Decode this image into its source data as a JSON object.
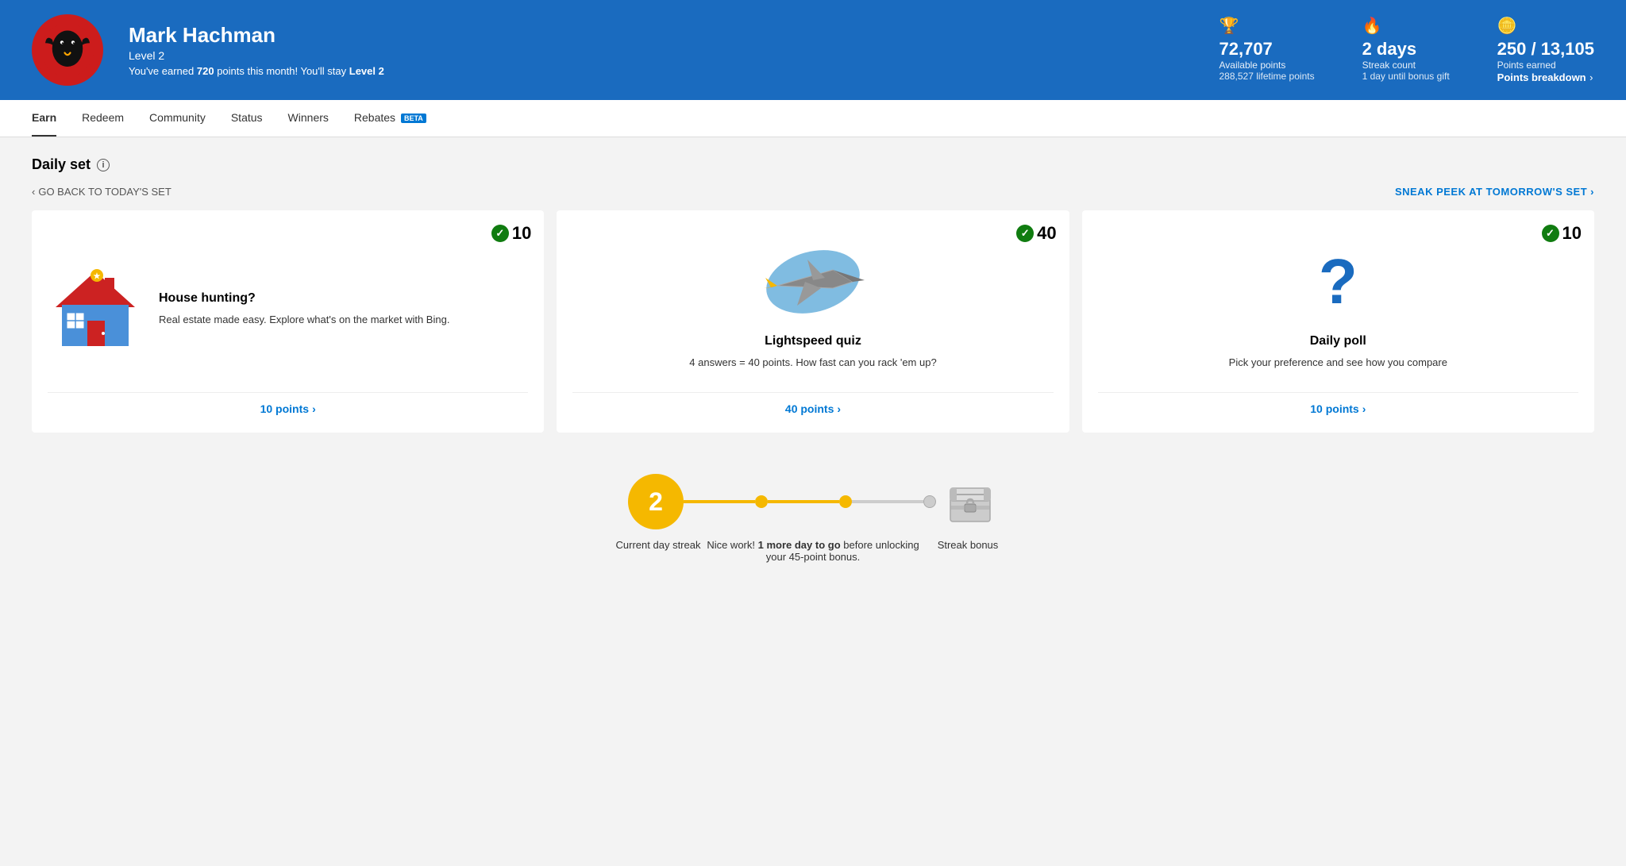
{
  "header": {
    "user": {
      "name": "Mark Hachman",
      "level": "Level 2",
      "monthly_message": "You've earned",
      "monthly_points": "720",
      "monthly_suffix": "points this month! You'll stay",
      "monthly_level": "Level 2"
    },
    "stats": {
      "points": {
        "icon": "trophy",
        "main": "72,707",
        "label": "Available points",
        "sub": "288,527 lifetime points"
      },
      "streak": {
        "icon": "flame",
        "main": "2 days",
        "label": "Streak count",
        "sub": "1 day until bonus gift"
      },
      "earnings": {
        "icon": "coins",
        "main": "250 / 13,105",
        "label": "Points earned",
        "link": "Points breakdown"
      }
    }
  },
  "nav": {
    "items": [
      {
        "label": "Earn",
        "active": true,
        "beta": false
      },
      {
        "label": "Redeem",
        "active": false,
        "beta": false
      },
      {
        "label": "Community",
        "active": false,
        "beta": false
      },
      {
        "label": "Status",
        "active": false,
        "beta": false
      },
      {
        "label": "Winners",
        "active": false,
        "beta": false
      },
      {
        "label": "Rebates",
        "active": false,
        "beta": true
      }
    ]
  },
  "daily_set": {
    "title": "Daily set",
    "back_link": "GO BACK TO TODAY'S SET",
    "sneak_link": "SNEAK PEEK AT TOMORROW'S SET",
    "cards": [
      {
        "id": "house-hunting",
        "points": "10",
        "completed": true,
        "title": "House hunting?",
        "description": "Real estate made easy. Explore what's on the market with Bing.",
        "footer_link": "10 points"
      },
      {
        "id": "lightspeed-quiz",
        "points": "40",
        "completed": true,
        "title": "Lightspeed quiz",
        "description": "4 answers = 40 points. How fast can you rack 'em up?",
        "footer_link": "40 points"
      },
      {
        "id": "daily-poll",
        "points": "10",
        "completed": true,
        "title": "Daily poll",
        "description": "Pick your preference and see how you compare",
        "footer_link": "10 points"
      }
    ]
  },
  "streak": {
    "current_number": "2",
    "current_label": "Current day streak",
    "middle_text_prefix": "Nice work!",
    "middle_bold": "1 more day to go",
    "middle_suffix": "before unlocking your 45-point bonus.",
    "bonus_label": "Streak bonus"
  }
}
